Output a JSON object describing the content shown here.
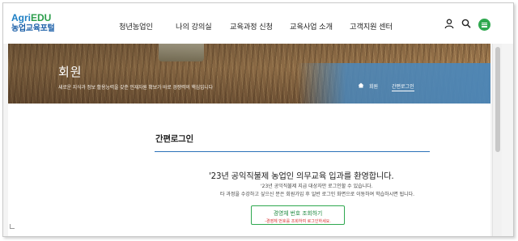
{
  "logo": {
    "brand_part1": "Agri",
    "brand_part2": "EDU",
    "subtitle": "농업교육포털"
  },
  "nav": {
    "items": [
      "청년농업인",
      "나의 강의실",
      "교육과정 신청",
      "교육사업 소개",
      "고객지원 센터"
    ]
  },
  "utility": {
    "icons": [
      "user-icon",
      "search-icon",
      "menu-icon"
    ],
    "menu_color": "#2fa84f"
  },
  "visual": {
    "title": "회원",
    "description": "새로운 지식과 정보 활용능력을 갖춘 인재자원 확보가 바로 경쟁력의 핵심입니다",
    "breadcrumb": [
      "회원",
      "간편로그인"
    ]
  },
  "login": {
    "title": "간편로그인",
    "welcome": "'23년 공익직불제 농업인 의무교육 입과를 환영합니다.",
    "line1": "'23년 공익직불제 지급 대상자만 로그인할 수 있습니다.",
    "line2": "타 과정을 수강하고 싶으신 분은 회원가입 후 일반 로그인 화면으로 이동하여 학습하시면 됩니다.",
    "button_label": "경영체 번호 조회하기",
    "button_note": "-경영체 번호를 조회하여 로그인하세요."
  },
  "colors": {
    "accent": "#2b72b8",
    "green": "#2fa84f",
    "warning": "#d93030"
  }
}
